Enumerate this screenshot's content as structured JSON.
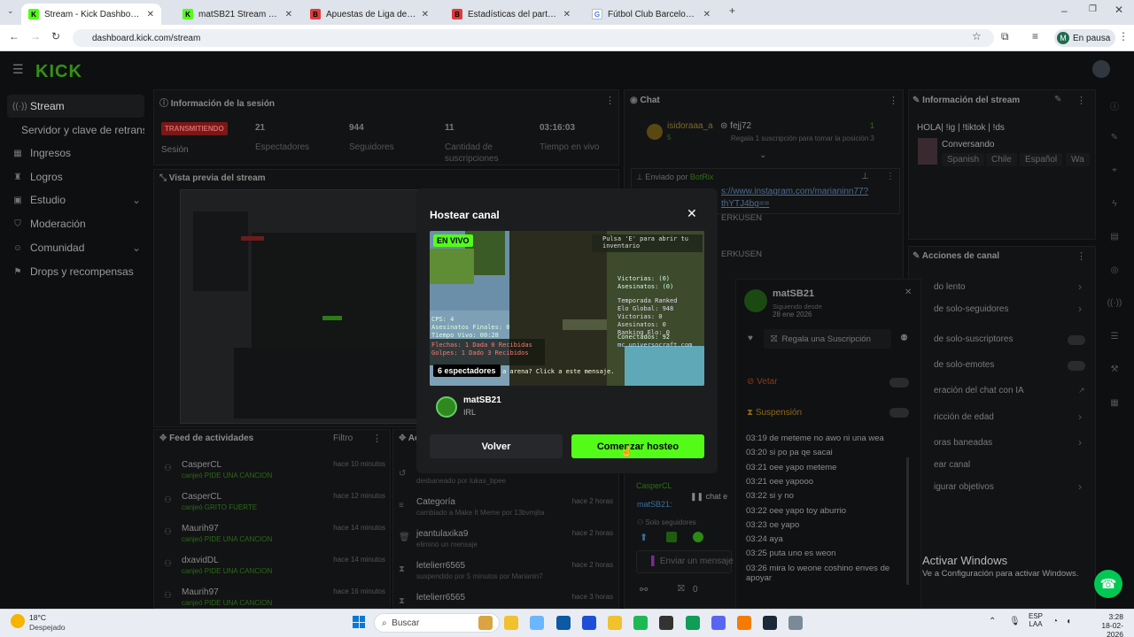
{
  "browser": {
    "tabs": [
      {
        "label": "Stream - Kick Dashboard",
        "fav": "k"
      },
      {
        "label": "matSB21 Stream - Watch Live o",
        "fav": "k"
      },
      {
        "label": "Apuestas de Liga de Primera - B",
        "fav": "b"
      },
      {
        "label": "Estadísticas del partido | Betano",
        "fav": "b"
      },
      {
        "label": "Fútbol Club Barcelona - Buscar",
        "fav": "g"
      }
    ],
    "url": "dashboard.kick.com/stream",
    "profile_initial": "M",
    "profile_status": "En pausa"
  },
  "app": {
    "logo": "KICK",
    "sidebar": [
      {
        "label": "Stream",
        "icon": "signal-icon",
        "glyph": "((·))"
      },
      {
        "label": "Servidor y clave de retransm",
        "icon": "",
        "glyph": ""
      },
      {
        "label": "Ingresos",
        "icon": "grid-icon",
        "glyph": "▦"
      },
      {
        "label": "Logros",
        "icon": "trophy-icon",
        "glyph": "♜"
      },
      {
        "label": "Estudio",
        "icon": "studio-icon",
        "glyph": "▣",
        "chevron": "⌄"
      },
      {
        "label": "Moderación",
        "icon": "shield-icon",
        "glyph": "⛉"
      },
      {
        "label": "Comunidad",
        "icon": "people-icon",
        "glyph": "☺",
        "chevron": "⌄"
      },
      {
        "label": "Drops y recompensas",
        "icon": "gift-icon",
        "glyph": "⚑"
      }
    ],
    "session": {
      "title": "Información de la sesión",
      "status": "TRANSMITIENDO",
      "status_sub": "Sesión",
      "stats": [
        {
          "value": "21",
          "label": "Espectadores"
        },
        {
          "value": "944",
          "label": "Seguidores"
        },
        {
          "value": "11",
          "label": "Cantidad de suscripciones"
        },
        {
          "value": "03:16:03",
          "label": "Tiempo en vivo"
        }
      ]
    },
    "preview_title": "Vista previa del stream",
    "feed": {
      "title": "Feed de actividades",
      "filter": "Filtro",
      "rows": [
        {
          "name": "CasperCL",
          "sub": "canjeó PIDE UNA CANCION",
          "time": "hace 10 minutos"
        },
        {
          "name": "CasperCL",
          "sub": "canjeó GRITO FUERTE",
          "time": "hace 12 minutos"
        },
        {
          "name": "Maurih97",
          "sub": "canjeó PIDE UNA CANCION",
          "time": "hace 14 minutos"
        },
        {
          "name": "dxavidDL",
          "sub": "canjeó PIDE UNA CANCION",
          "time": "hace 14 minutos"
        },
        {
          "name": "Maurih97",
          "sub": "canjeó PIDE UNA CANCION",
          "time": "hace 16 minutos"
        }
      ]
    },
    "mod_log": {
      "title": "Ac",
      "rows": [
        {
          "name": "",
          "sub": "desbaneado por lukas_bpee",
          "time": ""
        },
        {
          "name": "Categoría",
          "sub": "cambiado a Make It Meme por 13bvmjita",
          "time": "hace 2 horas"
        },
        {
          "name": "jeantulaxika9",
          "sub": "eliminó un mensaje",
          "time": "hace 2 horas"
        },
        {
          "name": "letelierr6565",
          "sub": "suspendido por 5 minutos por Marianin7",
          "time": "hace 2 horas"
        },
        {
          "name": "letelierr6565",
          "sub": "",
          "time": "hace 3 horas"
        }
      ]
    },
    "chat": {
      "title": "Chat",
      "top_user": "isidoraaa_a",
      "top_user_count": "5",
      "gift_user": "fejj72",
      "gift_count": "1",
      "gift_text": "Regala 1 suscripción para tomar la posición 3",
      "pinned_by_label": "Enviado por",
      "pinned_by": "BotRix",
      "pinned_text": "s://www.instagram.com/marianinn77?",
      "pinned_text2": "thYTJ4bg==",
      "names": [
        "ERKUSEN",
        "ERKUSEN"
      ],
      "input_placeholder": "Enviar un mensaje",
      "bottom_count": "0",
      "caspercl_label": "CasperCL",
      "paused": "chat e",
      "matsb": "matSB21:",
      "solo_seg": "Solo seguidores"
    },
    "profile_popup": {
      "name": "matSB21",
      "since_label": "Siguiendo desde",
      "since": "28 ene 2026",
      "gift_btn": "Regala una Suscripción",
      "vetar": "Vetar",
      "suspension": "Suspensión",
      "messages": [
        {
          "t": "03:19",
          "m": "de meteme no awo ni una wea"
        },
        {
          "t": "03:20",
          "m": "si po pa qe sacai"
        },
        {
          "t": "03:21",
          "m": "oee yapo meteme"
        },
        {
          "t": "03:21",
          "m": "oee yapooo"
        },
        {
          "t": "03:22",
          "m": "si y no"
        },
        {
          "t": "03:22",
          "m": "oee yapo toy aburrio"
        },
        {
          "t": "03:23",
          "m": "oe yapo"
        },
        {
          "t": "03:24",
          "m": "aya"
        },
        {
          "t": "03:25",
          "m": "puta uno es weon"
        },
        {
          "t": "03:26",
          "m": "mira lo weone coshino enves de apoyar"
        }
      ]
    },
    "stream_info": {
      "title": "Información del stream",
      "stream_title": "HOLA| !ig | !tiktok | !ds",
      "category": "Conversando",
      "tags": [
        "Spanish",
        "Chile",
        "Español",
        "Wa"
      ]
    },
    "channel_actions": {
      "title": "Acciones de canal",
      "items": [
        {
          "label": "do lento",
          "ctrl": "chevron"
        },
        {
          "label": "de solo-seguidores",
          "ctrl": "chevron"
        },
        {
          "label": "de solo-suscriptores",
          "ctrl": "toggle"
        },
        {
          "label": "de solo-emotes",
          "ctrl": "toggle"
        },
        {
          "label": "eración del chat con IA",
          "ctrl": "link"
        },
        {
          "label": "ricción de edad",
          "ctrl": "chevron"
        },
        {
          "label": "oras baneadas",
          "ctrl": "chevron"
        },
        {
          "label": "ear canal",
          "ctrl": "none"
        },
        {
          "label": "igurar objetivos",
          "ctrl": "chevron"
        }
      ]
    },
    "watermark": {
      "line1": "Activar Windows",
      "line2": "Ve a Configuración para activar Windows."
    }
  },
  "modal": {
    "title": "Hostear canal",
    "live_badge": "EN VIVO",
    "viewers": "6 espectadores",
    "channel_name": "matSB21",
    "channel_category": "IRL",
    "back_label": "Volver",
    "host_label": "Comenzar hosteo",
    "game_hud": {
      "prompt": "Pulsa 'E' para abrir tu inventario",
      "stats": "Victorias: (0)\nAsesinatos: (0)",
      "left_stats": "CPS: 4\nAsesinatos Finales: 0\nTiempo Vivo: 00:28",
      "arrows": "Flechas: 1 Dada 0 Recibidas\nGolpes: 1 Dado 3 Recibidos",
      "right_stats": "Temporada Ranked\nElo Global: 948\nVictorias: 0\nAsesinatos: 0\nRanking Elo: 0",
      "connected": "Conectados: 92",
      "server": "mc.universocraft.com",
      "chat_msg": "a arena? Click a este mensaje."
    }
  },
  "taskbar": {
    "weather_temp": "18°C",
    "weather_text": "Despejado",
    "search": "Buscar",
    "lang1": "ESP",
    "lang2": "LAA",
    "time": "3:28",
    "date": "18-02-2026"
  }
}
